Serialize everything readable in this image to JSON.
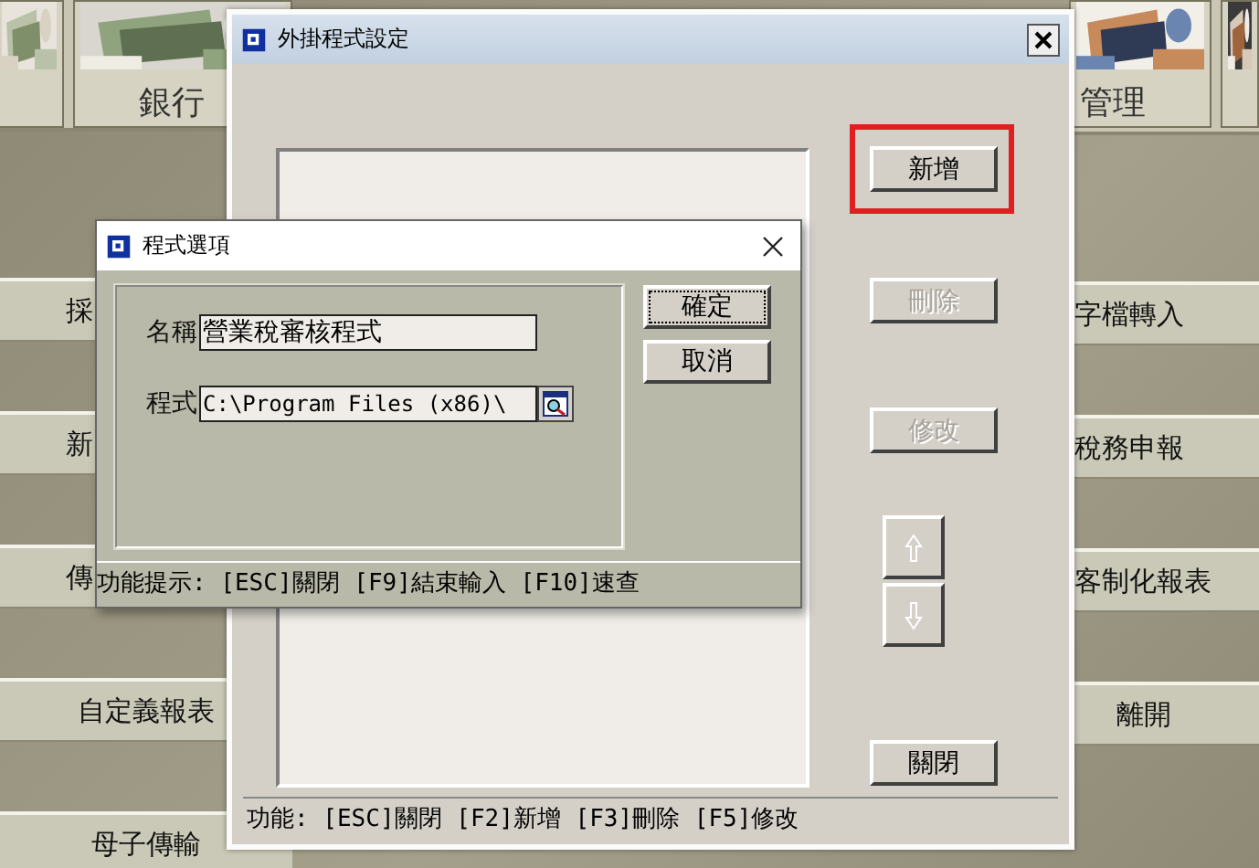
{
  "background": {
    "left_tiles": [
      {
        "kind": "picture"
      },
      {
        "kind": "picture",
        "label": "銀行"
      }
    ],
    "right_tiles": [
      {
        "kind": "picture",
        "label": "管理"
      },
      {
        "kind": "picture"
      }
    ],
    "left_menu": [
      "採",
      "新",
      "傳",
      "自定義報表",
      "母子傳輸"
    ],
    "right_menu": [
      "字檔轉入",
      "稅務申報",
      "客制化報表",
      "離開"
    ]
  },
  "main_dialog": {
    "title": "外掛程式設定",
    "buttons": [
      {
        "label": "新增",
        "disabled": false,
        "highlighted": true
      },
      {
        "label": "刪除",
        "disabled": true,
        "highlighted": false
      },
      {
        "label": "修改",
        "disabled": true,
        "highlighted": false
      }
    ],
    "arrow_buttons": [
      {
        "kind": "up",
        "disabled": true
      },
      {
        "kind": "down",
        "disabled": true
      }
    ],
    "close_label": "關閉",
    "status": "功能: [ESC]關閉 [F2]新增 [F3]刪除 [F5]修改"
  },
  "options_dialog": {
    "title": "程式選項",
    "fields": [
      {
        "label": "名稱",
        "value": "營業稅審核程式",
        "kind": "text"
      },
      {
        "label": "程式",
        "value": "C:\\Program Files (x86)\\",
        "kind": "browse"
      }
    ],
    "buttons": [
      {
        "label": "確定",
        "focused": true
      },
      {
        "label": "取消",
        "focused": false
      }
    ],
    "status": "功能提示: [ESC]關閉 [F9]結束輸入 [F10]速查"
  }
}
